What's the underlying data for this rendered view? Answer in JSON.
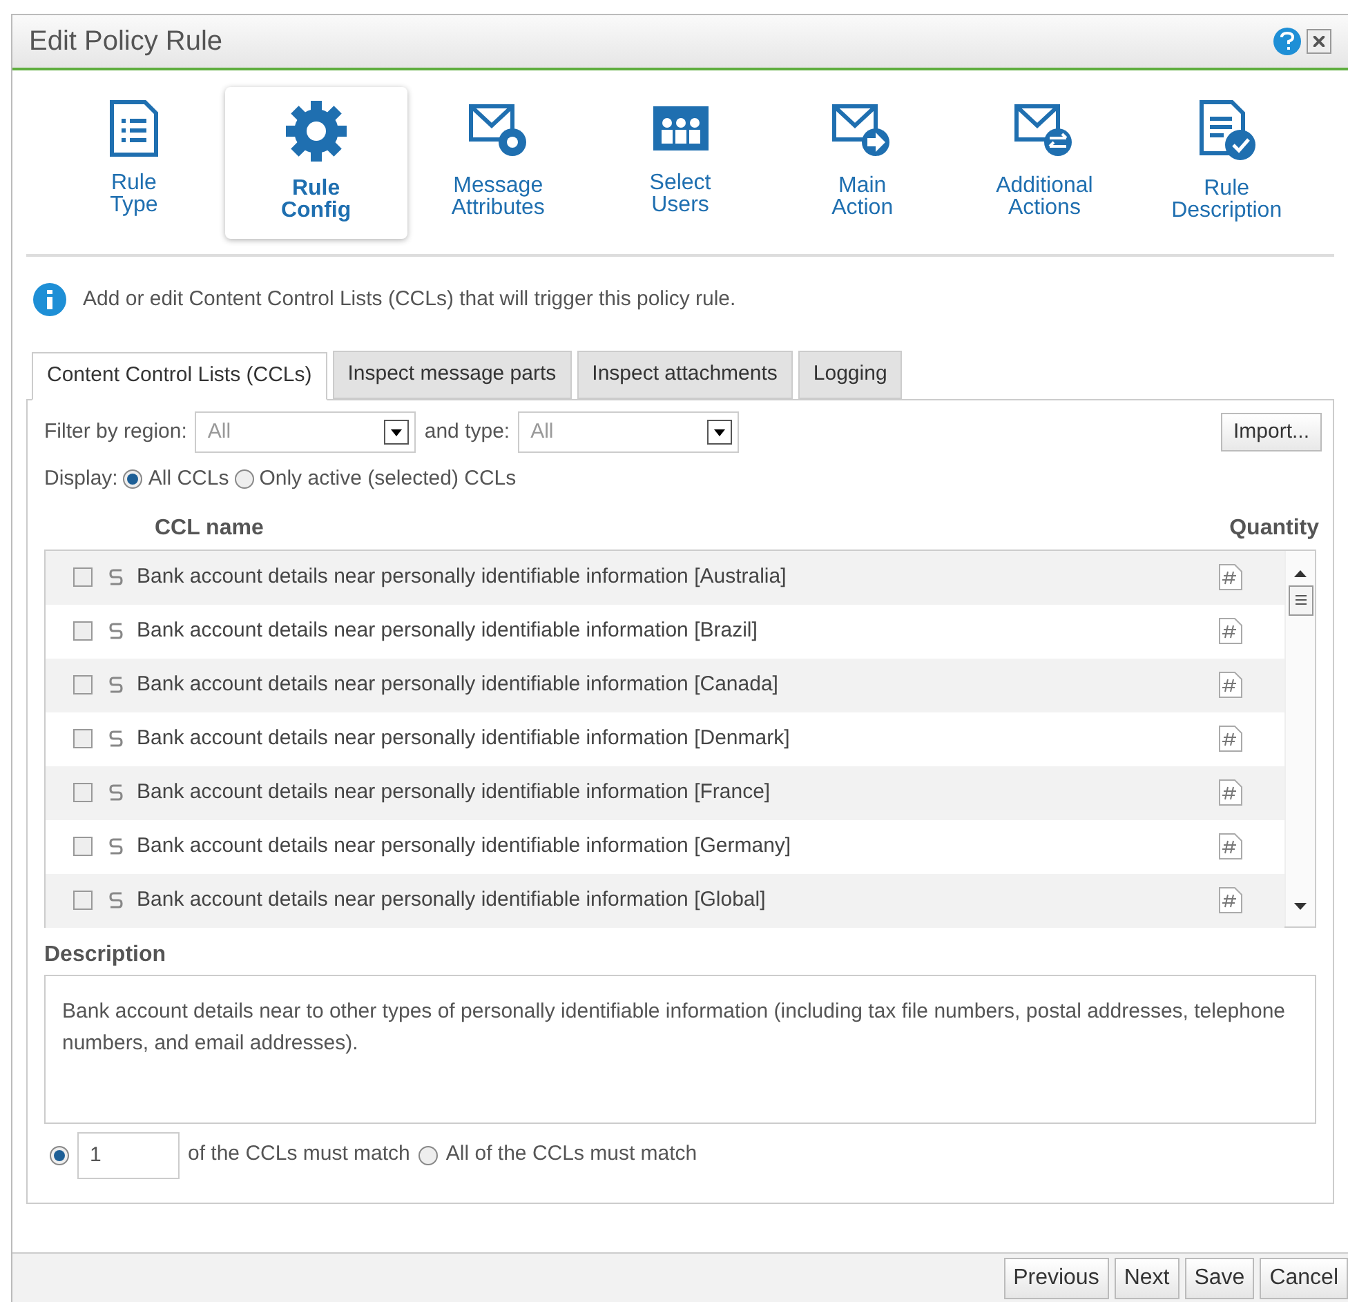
{
  "window": {
    "title": "Edit Policy Rule"
  },
  "steps": [
    {
      "label": "Rule Type",
      "kind": "list",
      "selected": false
    },
    {
      "label": "Rule Config",
      "kind": "gear",
      "selected": true
    },
    {
      "label": "Message Attributes",
      "kind": "mail-gear",
      "selected": false
    },
    {
      "label": "Select Users",
      "kind": "users",
      "selected": false
    },
    {
      "label": "Main Action",
      "kind": "mail-arrow",
      "selected": false
    },
    {
      "label": "Additional Actions",
      "kind": "mail-arrows",
      "selected": false
    },
    {
      "label": "Rule Description",
      "kind": "doc-check",
      "selected": false
    }
  ],
  "info": "Add or edit Content Control Lists (CCLs) that will trigger this policy rule.",
  "tabs": [
    {
      "label": "Content Control Lists (CCLs)",
      "selected": true
    },
    {
      "label": "Inspect message parts",
      "selected": false
    },
    {
      "label": "Inspect attachments",
      "selected": false
    },
    {
      "label": "Logging",
      "selected": false
    }
  ],
  "filter": {
    "region_label": "Filter by region:",
    "region_value": "All",
    "type_label": "and type:",
    "type_value": "All",
    "import_button": "Import..."
  },
  "display": {
    "label": "Display:",
    "options": [
      {
        "label": "All CCLs",
        "selected": true
      },
      {
        "label": "Only active (selected) CCLs",
        "selected": false
      }
    ]
  },
  "table": {
    "columns": [
      "CCL name",
      "Quantity"
    ],
    "rows": [
      {
        "name": "Bank account details near personally identifiable information [Australia]",
        "checked": false
      },
      {
        "name": "Bank account details near personally identifiable information [Brazil]",
        "checked": false
      },
      {
        "name": "Bank account details near personally identifiable information [Canada]",
        "checked": false
      },
      {
        "name": "Bank account details near personally identifiable information [Denmark]",
        "checked": false
      },
      {
        "name": "Bank account details near personally identifiable information [France]",
        "checked": false
      },
      {
        "name": "Bank account details near personally identifiable information [Germany]",
        "checked": false
      },
      {
        "name": "Bank account details near personally identifiable information [Global]",
        "checked": false
      }
    ]
  },
  "description": {
    "label": "Description",
    "text": "Bank account details near to other types of personally identifiable information (including tax file numbers, postal addresses, telephone numbers, and email addresses)."
  },
  "match": {
    "count_selected": true,
    "count_value": "1",
    "count_label": "of the CCLs must match",
    "all_selected": false,
    "all_label": "All of the CCLs must match"
  },
  "buttons": [
    "Previous",
    "Next",
    "Save",
    "Cancel"
  ]
}
